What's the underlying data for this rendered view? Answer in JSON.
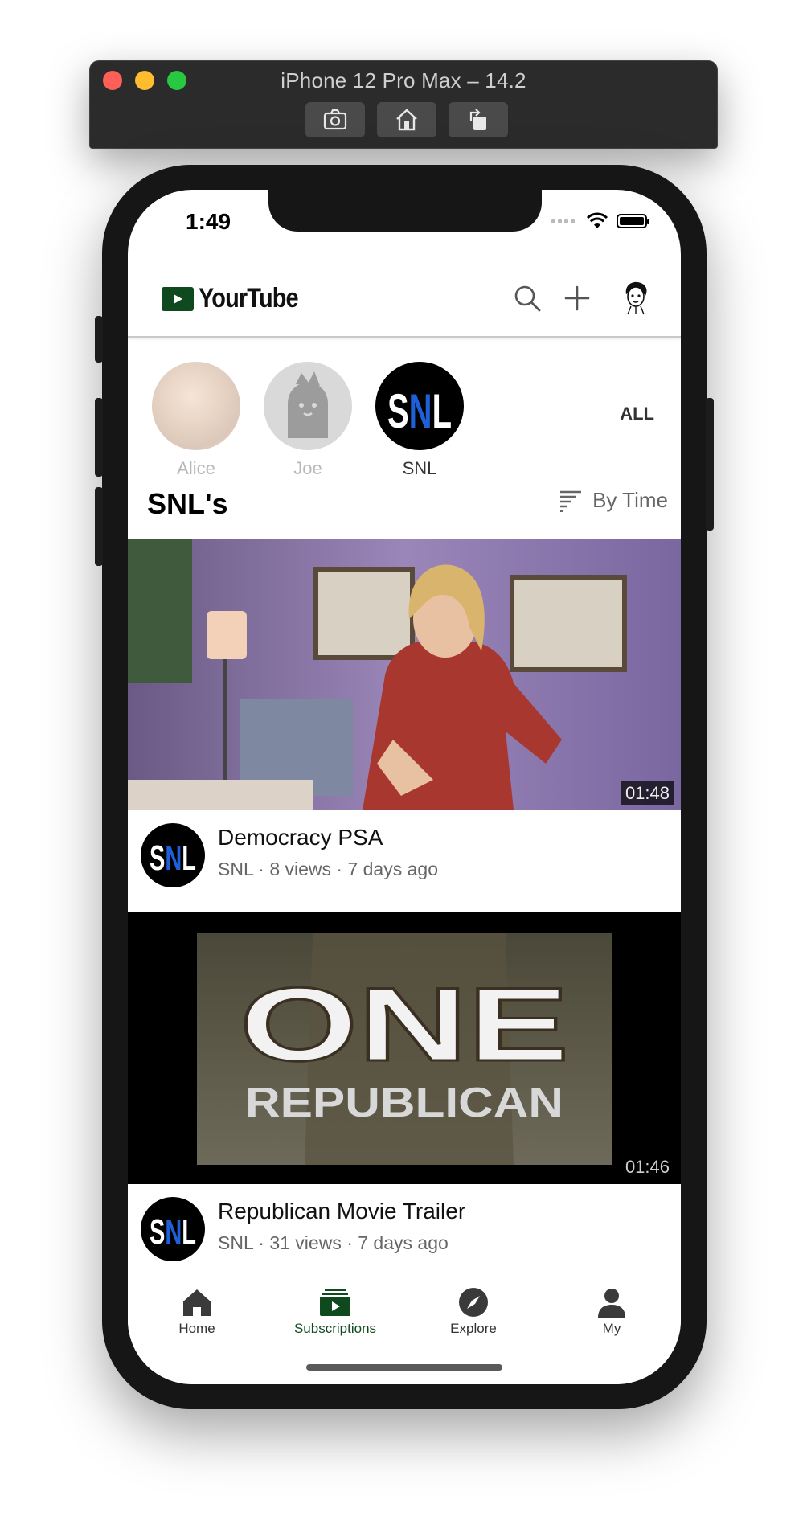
{
  "simulator": {
    "title": "iPhone 12 Pro Max – 14.2",
    "buttons": [
      "screenshot-icon",
      "home-icon",
      "rotate-icon"
    ]
  },
  "status_bar": {
    "time": "1:49"
  },
  "header": {
    "app_name": "YourTube",
    "icons": [
      "search-icon",
      "plus-icon",
      "profile-avatar-icon"
    ]
  },
  "subscriptions": {
    "channels": [
      {
        "name": "Alice",
        "active": false
      },
      {
        "name": "Joe",
        "active": false
      },
      {
        "name": "SNL",
        "active": true
      }
    ],
    "all_label": "ALL"
  },
  "feed": {
    "title": "SNL's",
    "sort_label": "By Time"
  },
  "videos": [
    {
      "title": "Democracy PSA",
      "subtitle": "SNL · 8 views · 7 days ago",
      "duration": "01:48",
      "channel_logo_text": "SNL"
    },
    {
      "title": "Republican Movie Trailer",
      "subtitle": "SNL · 31 views · 7 days ago",
      "duration": "01:46",
      "thumbnail_text": [
        "ONE",
        "REPUBLICAN"
      ],
      "channel_logo_text": "SNL"
    }
  ],
  "tabbar": {
    "tabs": [
      {
        "label": "Home",
        "icon": "home-icon",
        "active": false
      },
      {
        "label": "Subscriptions",
        "icon": "subscriptions-icon",
        "active": true
      },
      {
        "label": "Explore",
        "icon": "compass-icon",
        "active": false
      },
      {
        "label": "My",
        "icon": "person-icon",
        "active": false
      }
    ]
  },
  "colors": {
    "brand_green": "#0f4a1e",
    "snl_blue": "#1f5fd8"
  }
}
